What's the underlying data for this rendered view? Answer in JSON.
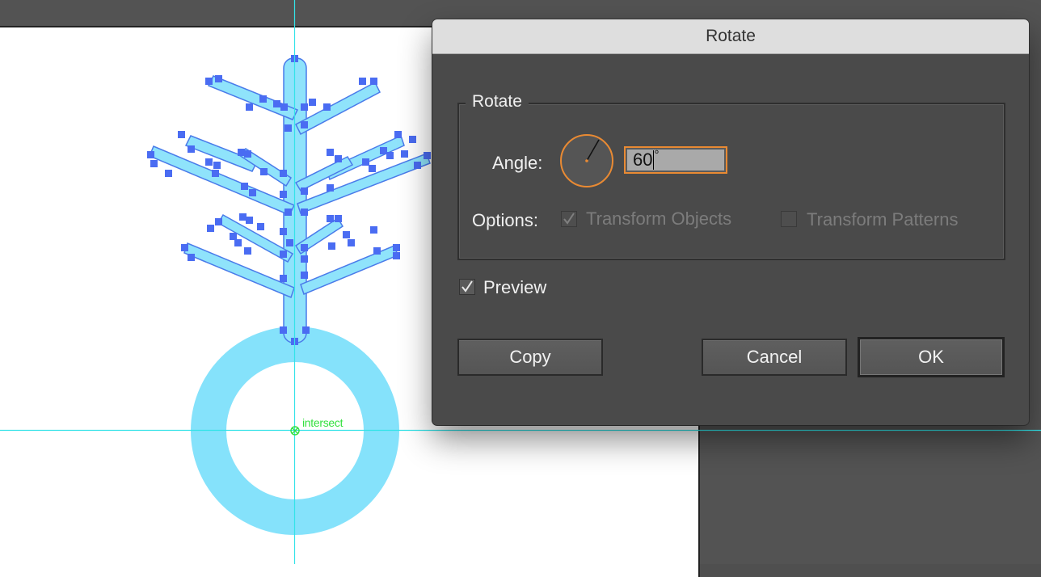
{
  "dialog": {
    "title": "Rotate",
    "group_label": "Rotate",
    "angle_label": "Angle:",
    "angle_value": "60",
    "angle_unit": "°",
    "options_label": "Options:",
    "transform_objects_label": "Transform Objects",
    "transform_objects_checked": true,
    "transform_objects_enabled": false,
    "transform_patterns_label": "Transform Patterns",
    "transform_patterns_checked": false,
    "transform_patterns_enabled": false,
    "preview_label": "Preview",
    "preview_checked": true,
    "buttons": {
      "copy": "Copy",
      "cancel": "Cancel",
      "ok": "OK"
    }
  },
  "canvas": {
    "smart_guide_label": "intersect"
  },
  "colors": {
    "selection_blue": "#4a7bea",
    "shape_fill": "#8fe3fb",
    "guide_cyan": "#34e3e8",
    "smart_guide_green": "#33e03f",
    "focus_orange": "#e98a33"
  }
}
